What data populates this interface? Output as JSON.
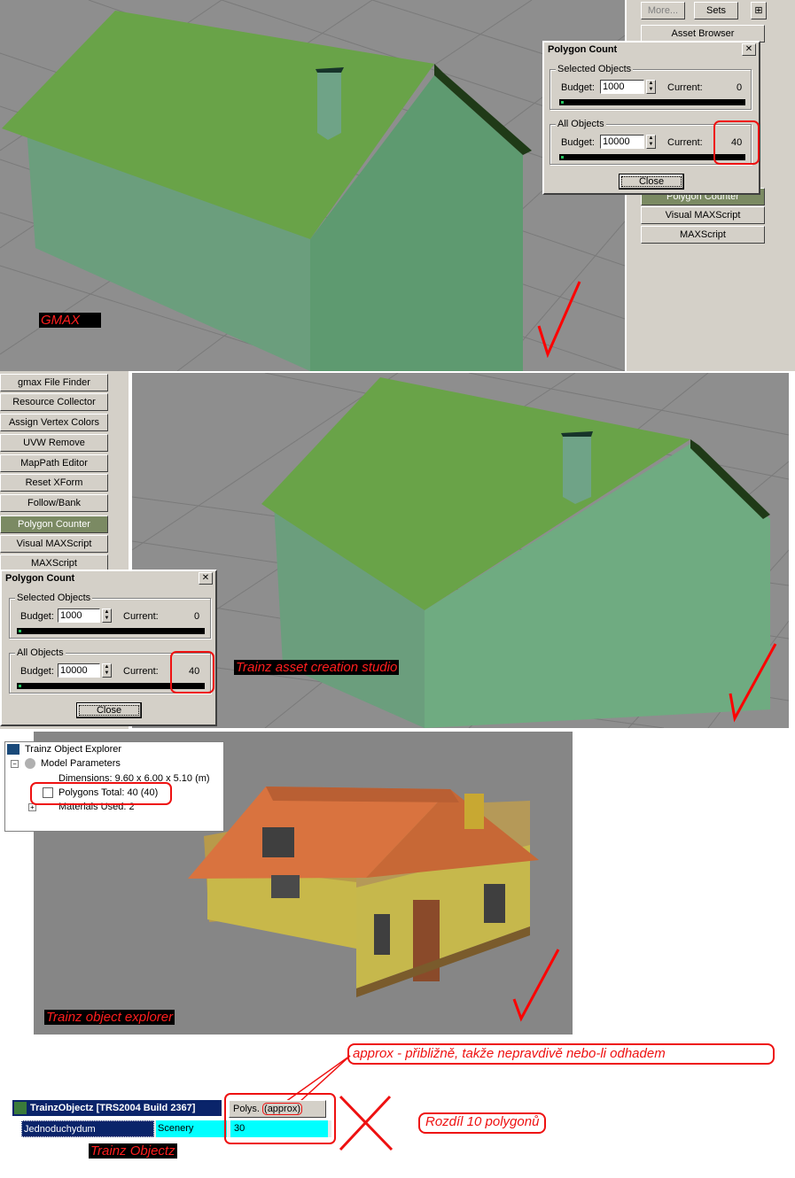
{
  "gmax_top": {
    "toolbar": {
      "more_label": "More...",
      "sets_label": "Sets"
    },
    "utilities": [
      "Asset Browser",
      "Polygon Counter",
      "Visual MAXScript",
      "MAXScript"
    ],
    "label": "GMAX"
  },
  "polycount_top": {
    "title": "Polygon Count",
    "selected_group": "Selected Objects",
    "selected_budget_label": "Budget:",
    "selected_budget": "1000",
    "selected_current_label": "Current:",
    "selected_current": "0",
    "all_group": "All Objects",
    "all_budget_label": "Budget:",
    "all_budget": "10000",
    "all_current_label": "Current:",
    "all_current": "40",
    "close_label": "Close"
  },
  "gmax_mid": {
    "utilities": [
      "gmax File Finder",
      "Resource Collector",
      "Assign Vertex Colors",
      "UVW Remove",
      "MapPath Editor",
      "Reset XForm",
      "Follow/Bank",
      "Polygon Counter",
      "Visual MAXScript",
      "MAXScript"
    ],
    "label": "Trainz asset creation studio"
  },
  "polycount_mid": {
    "title": "Polygon Count",
    "selected_group": "Selected Objects",
    "selected_budget_label": "Budget:",
    "selected_budget": "1000",
    "selected_current_label": "Current:",
    "selected_current": "0",
    "all_group": "All Objects",
    "all_budget_label": "Budget:",
    "all_budget": "10000",
    "all_current_label": "Current:",
    "all_current": "40",
    "close_label": "Close"
  },
  "explorer": {
    "title": "Trainz Object Explorer",
    "model_params": "Model Parameters",
    "dimensions": "Dimensions: 9.60 x 6.00 x 5.10 (m)",
    "polygons": "Polygons Total: 40 (40)",
    "materials": "Materials Used: 2",
    "label": "Trainz object explorer"
  },
  "objectz": {
    "window_title": "TrainzObjectz  [TRS2004 Build 2367]",
    "name_cell": "Jednoduchydum",
    "type_cell": "Scenery",
    "polys_header": "Polys.",
    "approx_header": "(approx)",
    "polys_value": "30",
    "label": "Trainz Objectz"
  },
  "annotations": {
    "approx_note": "approx - přibližně, takže nepravdivě nebo-li odhadem",
    "difference_note": "Rozdíl 10 polygonů"
  },
  "colors": {
    "roof_green": "#6aa84f",
    "wall_green": "#6b9e7d",
    "annotation_red": "#ee1111",
    "accent_active": "#7b8a63"
  },
  "icons": [
    "checkmark-icon",
    "x-mark-icon",
    "close-icon",
    "spinner-arrows-icon",
    "tree-expand-icon",
    "app-icon"
  ]
}
